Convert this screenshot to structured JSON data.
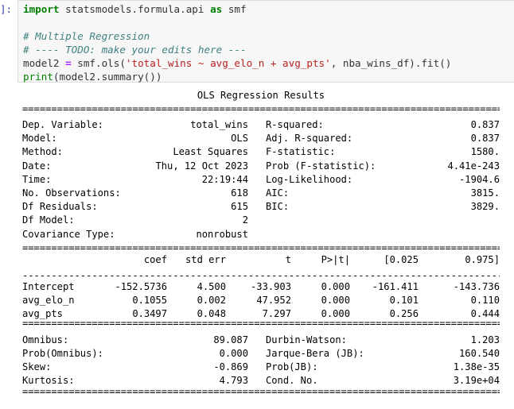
{
  "cell": {
    "prompt": "]:",
    "code": {
      "line1": {
        "kw": "import",
        "rest": " statsmodels.formula.api ",
        "kw2": "as",
        "rest2": " smf"
      },
      "line3": "# Multiple Regression",
      "line4": "# ---- TODO: make your edits here ---",
      "line5": {
        "a": "model2 ",
        "eq": "=",
        "b": " smf.ols(",
        "str": "'total_wins ~ avg_elo_n + avg_pts'",
        "c": ", nba_wins_df).fit()"
      },
      "line6": {
        "fn": "print",
        "rest": "(model2.summary())"
      }
    }
  },
  "output": {
    "title": "OLS Regression Results",
    "info_rows": [
      {
        "l1": "Dep. Variable:",
        "v1": "total_wins",
        "l2": "R-squared:",
        "v2": "0.837"
      },
      {
        "l1": "Model:",
        "v1": "OLS",
        "l2": "Adj. R-squared:",
        "v2": "0.837"
      },
      {
        "l1": "Method:",
        "v1": "Least Squares",
        "l2": "F-statistic:",
        "v2": "1580."
      },
      {
        "l1": "Date:",
        "v1": "Thu, 12 Oct 2023",
        "l2": "Prob (F-statistic):",
        "v2": "4.41e-243"
      },
      {
        "l1": "Time:",
        "v1": "22:19:44",
        "l2": "Log-Likelihood:",
        "v2": "-1904.6"
      },
      {
        "l1": "No. Observations:",
        "v1": "618",
        "l2": "AIC:",
        "v2": "3815."
      },
      {
        "l1": "Df Residuals:",
        "v1": "615",
        "l2": "BIC:",
        "v2": "3829."
      },
      {
        "l1": "Df Model:",
        "v1": "2",
        "l2": "",
        "v2": ""
      },
      {
        "l1": "Covariance Type:",
        "v1": "nonrobust",
        "l2": "",
        "v2": ""
      }
    ],
    "coef_headers": [
      "coef",
      "std err",
      "t",
      "P>|t|",
      "[0.025",
      "0.975]"
    ],
    "coef_rows": [
      {
        "name": "Intercept",
        "vals": [
          "-152.5736",
          "4.500",
          "-33.903",
          "0.000",
          "-161.411",
          "-143.736"
        ]
      },
      {
        "name": "avg_elo_n",
        "vals": [
          "0.1055",
          "0.002",
          "47.952",
          "0.000",
          "0.101",
          "0.110"
        ]
      },
      {
        "name": "avg_pts",
        "vals": [
          "0.3497",
          "0.048",
          "7.297",
          "0.000",
          "0.256",
          "0.444"
        ]
      }
    ],
    "diag_rows": [
      {
        "l1": "Omnibus:",
        "v1": "89.087",
        "l2": "Durbin-Watson:",
        "v2": "1.203"
      },
      {
        "l1": "Prob(Omnibus):",
        "v1": "0.000",
        "l2": "Jarque-Bera (JB):",
        "v2": "160.540"
      },
      {
        "l1": "Skew:",
        "v1": "-0.869",
        "l2": "Prob(JB):",
        "v2": "1.38e-35"
      },
      {
        "l1": "Kurtosis:",
        "v1": "4.793",
        "l2": "Cond. No.",
        "v2": "3.19e+04"
      }
    ]
  }
}
